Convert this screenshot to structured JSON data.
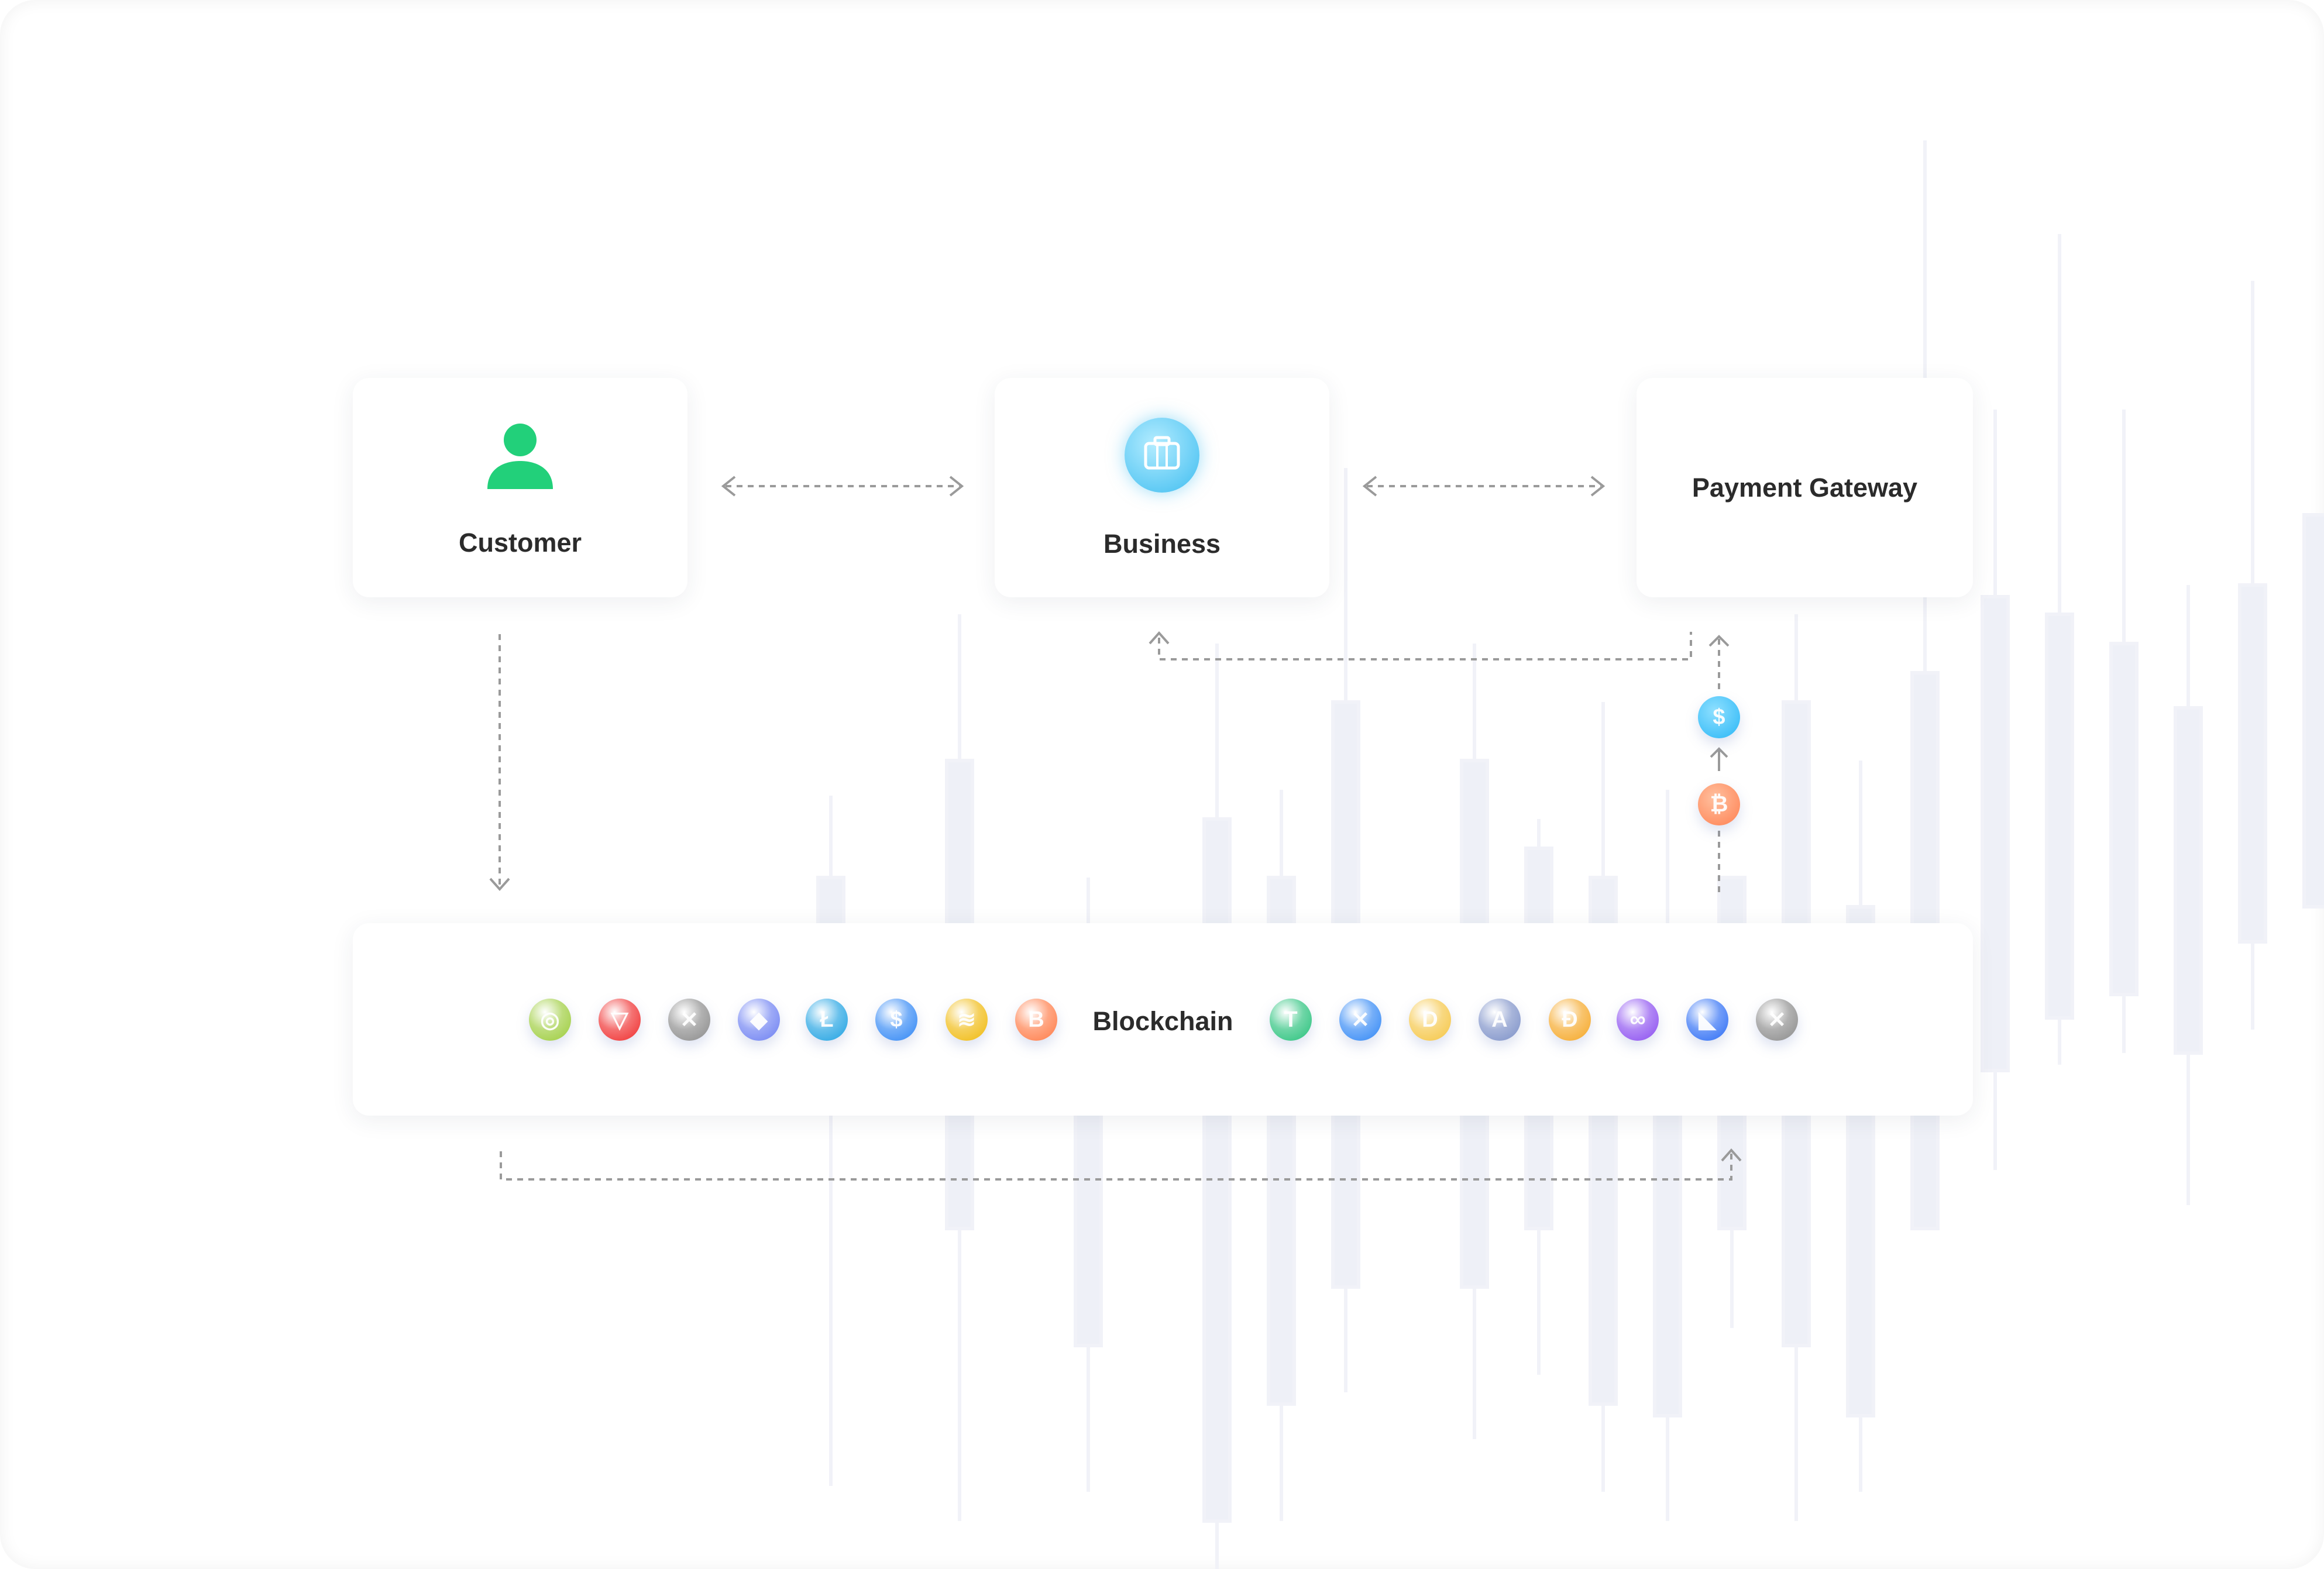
{
  "nodes": {
    "customer": {
      "label": "Customer",
      "icon": "person-icon",
      "color": "#22d07a"
    },
    "business": {
      "label": "Business",
      "icon": "briefcase-icon",
      "color": "#4fc3f7"
    },
    "payment_gateway": {
      "label": "Payment Gateway"
    },
    "blockchain": {
      "label": "Blockchain"
    }
  },
  "flow_icons": [
    {
      "icon": "dollar-coin-icon",
      "glyph": "$",
      "color": "#29b6f6"
    },
    {
      "icon": "bitcoin-coin-icon",
      "glyph": "₿",
      "color": "#ff7f50"
    }
  ],
  "coins_left": [
    {
      "icon": "celo-coin-icon",
      "glyph": "◎",
      "color": "#9ccc3a"
    },
    {
      "icon": "tron-coin-icon",
      "glyph": "▽",
      "color": "#ef2b2b"
    },
    {
      "icon": "xrp-coin-icon",
      "glyph": "✕",
      "color": "#8a8a8a"
    },
    {
      "icon": "ethereum-coin-icon",
      "glyph": "◆",
      "color": "#6c7ff2"
    },
    {
      "icon": "litecoin-coin-icon",
      "glyph": "Ł",
      "color": "#1da1e2"
    },
    {
      "icon": "usdc-coin-icon",
      "glyph": "$",
      "color": "#2f86f5"
    },
    {
      "icon": "binance-usd-coin-icon",
      "glyph": "≋",
      "color": "#f0b90b"
    },
    {
      "icon": "bitcoin-coin-icon",
      "glyph": "B",
      "color": "#ff7a45"
    }
  ],
  "coins_right": [
    {
      "icon": "tether-coin-icon",
      "glyph": "T",
      "color": "#26c17a"
    },
    {
      "icon": "swap-coin-icon",
      "glyph": "✕",
      "color": "#2f86f5"
    },
    {
      "icon": "dash-coin-icon",
      "glyph": "D",
      "color": "#f5c542"
    },
    {
      "icon": "aave-coin-icon",
      "glyph": "A",
      "color": "#7b8fc7"
    },
    {
      "icon": "dai-coin-icon",
      "glyph": "Đ",
      "color": "#f5a623"
    },
    {
      "icon": "polygon-coin-icon",
      "glyph": "∞",
      "color": "#8a4cf0"
    },
    {
      "icon": "loopring-coin-icon",
      "glyph": "◣",
      "color": "#2b6cf5"
    },
    {
      "icon": "0x-coin-icon",
      "glyph": "✕",
      "color": "#8a8a8a"
    }
  ]
}
